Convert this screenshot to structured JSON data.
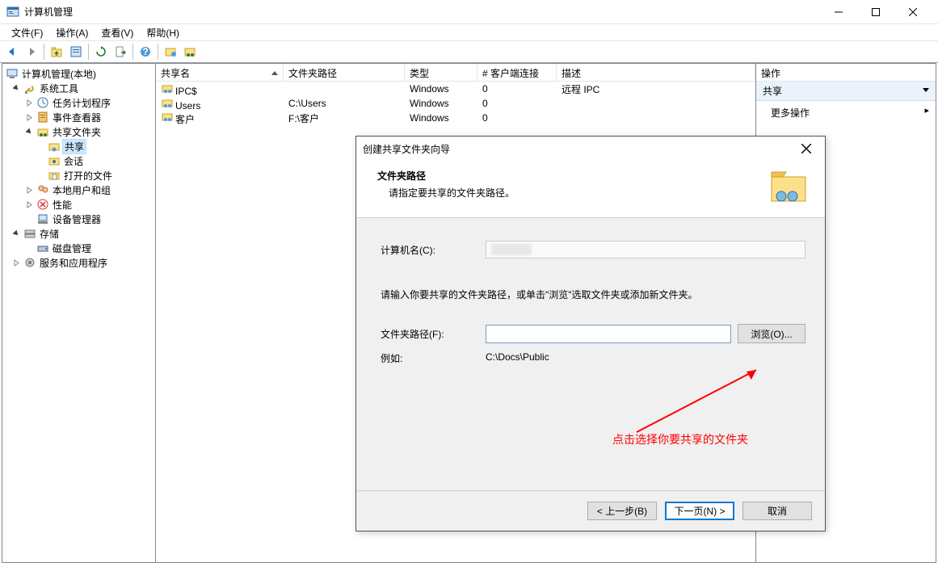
{
  "window": {
    "title": "计算机管理",
    "min": "—",
    "max": "☐",
    "close": "✕"
  },
  "menu": {
    "file": "文件(F)",
    "action": "操作(A)",
    "view": "查看(V)",
    "help": "帮助(H)"
  },
  "tree": {
    "root": "计算机管理(本地)",
    "system_tools": "系统工具",
    "task_scheduler": "任务计划程序",
    "event_viewer": "事件查看器",
    "shared_folders": "共享文件夹",
    "shares": "共享",
    "sessions": "会话",
    "open_files": "打开的文件",
    "local_users": "本地用户和组",
    "performance": "性能",
    "device_manager": "设备管理器",
    "storage": "存储",
    "disk_mgmt": "磁盘管理",
    "services_apps": "服务和应用程序"
  },
  "list": {
    "headers": {
      "name": "共享名",
      "path": "文件夹路径",
      "type": "类型",
      "connections": "# 客户端连接",
      "description": "描述"
    },
    "rows": [
      {
        "name": "IPC$",
        "path": "",
        "type": "Windows",
        "conn": "0",
        "desc": "远程 IPC"
      },
      {
        "name": "Users",
        "path": "C:\\Users",
        "type": "Windows",
        "conn": "0",
        "desc": ""
      },
      {
        "name": "客户",
        "path": "F:\\客户",
        "type": "Windows",
        "conn": "0",
        "desc": ""
      }
    ]
  },
  "actions": {
    "header": "操作",
    "section": "共享",
    "more": "更多操作"
  },
  "wizard": {
    "title": "创建共享文件夹向导",
    "heading": "文件夹路径",
    "subheading": "请指定要共享的文件夹路径。",
    "computer_label": "计算机名(C):",
    "instruction": "请输入你要共享的文件夹路径，或单击\"浏览\"选取文件夹或添加新文件夹。",
    "path_label": "文件夹路径(F):",
    "browse": "浏览(O)...",
    "example_label": "例如:",
    "example_value": "C:\\Docs\\Public",
    "back": "< 上一步(B)",
    "next": "下一页(N) >",
    "cancel": "取消"
  },
  "annotation": "点击选择你要共享的文件夹"
}
